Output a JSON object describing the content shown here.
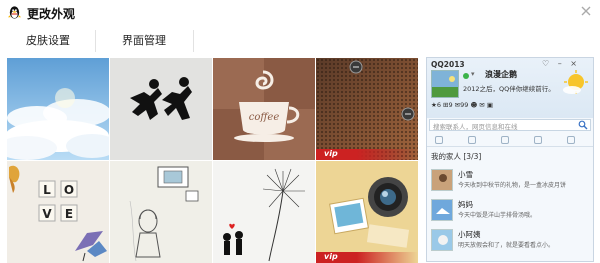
{
  "window": {
    "title": "更改外观",
    "close_label": "×"
  },
  "tabs": [
    {
      "label": "皮肤设置"
    },
    {
      "label": "界面管理"
    }
  ],
  "skins": {
    "vip_badge": "vip",
    "coffee_text": "coffee",
    "love_tiles": [
      "L",
      "O",
      "V",
      "E"
    ]
  },
  "preview": {
    "app_name": "QQ2013",
    "window_buttons": "♡ – ×",
    "nickname": "浪漫企鹅",
    "signature": "2012之后，QQ伴你继续前行。",
    "icons_row": "★6 ⊞9 ✉99 ☻ ✉ ▣",
    "search_placeholder": "搜索联系人，网页信息和在线",
    "group_label": "我的家人 [3/3]",
    "contacts": [
      {
        "name": "小雪",
        "signature": "今天收到中秋节的礼物，是一盒冰皮月饼"
      },
      {
        "name": "妈妈",
        "signature": "今天中饭是洋山芋排骨汤哦。"
      },
      {
        "name": "小阿姨",
        "signature": "明天放假会和了，就是要看看点小。"
      }
    ]
  }
}
